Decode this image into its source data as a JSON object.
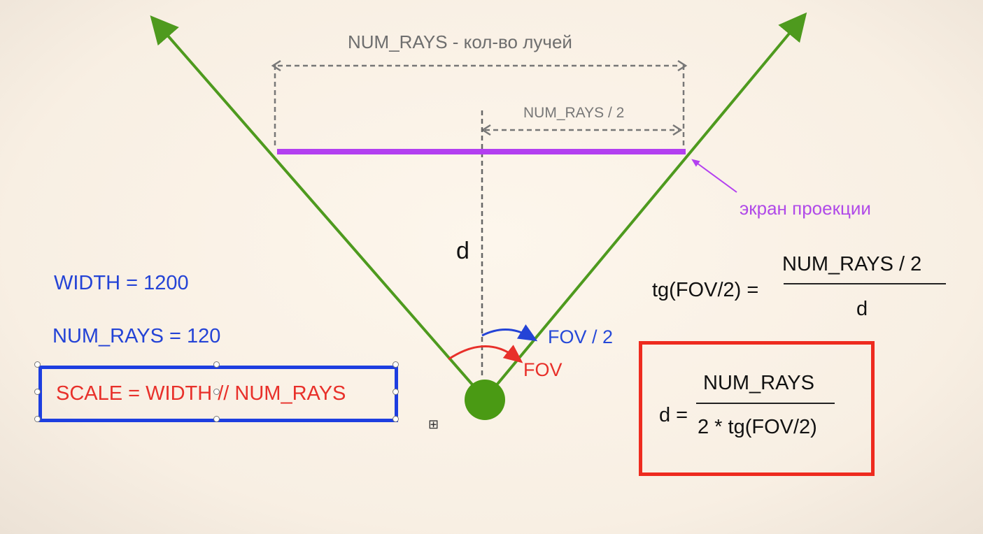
{
  "labels": {
    "num_rays_span": "NUM_RAYS - кол-во лучей",
    "num_rays_half": "NUM_RAYS / 2",
    "distance": "d",
    "projection_screen": "экран проекции",
    "fov_half": "FOV / 2",
    "fov": "FOV"
  },
  "params": {
    "width": "WIDTH = 1200",
    "num_rays": "NUM_RAYS = 120",
    "scale": "SCALE = WIDTH // NUM_RAYS"
  },
  "formula_tg": {
    "left": "tg(FOV/2) =",
    "numerator": "NUM_RAYS / 2",
    "denominator": "d"
  },
  "formula_d": {
    "left": "d =",
    "numerator": "NUM_RAYS",
    "denominator": "2 * tg(FOV/2)"
  },
  "icons": {
    "move": "move-handle-icon"
  },
  "colors": {
    "background": "#fbf4ea",
    "rays": "#4e9a1e",
    "screen": "#b33ff0",
    "dimension": "#777777",
    "blue": "#2443d6",
    "red": "#e8302a",
    "box_blue": "#1d3ee0",
    "box_red": "#ee2b1f"
  }
}
